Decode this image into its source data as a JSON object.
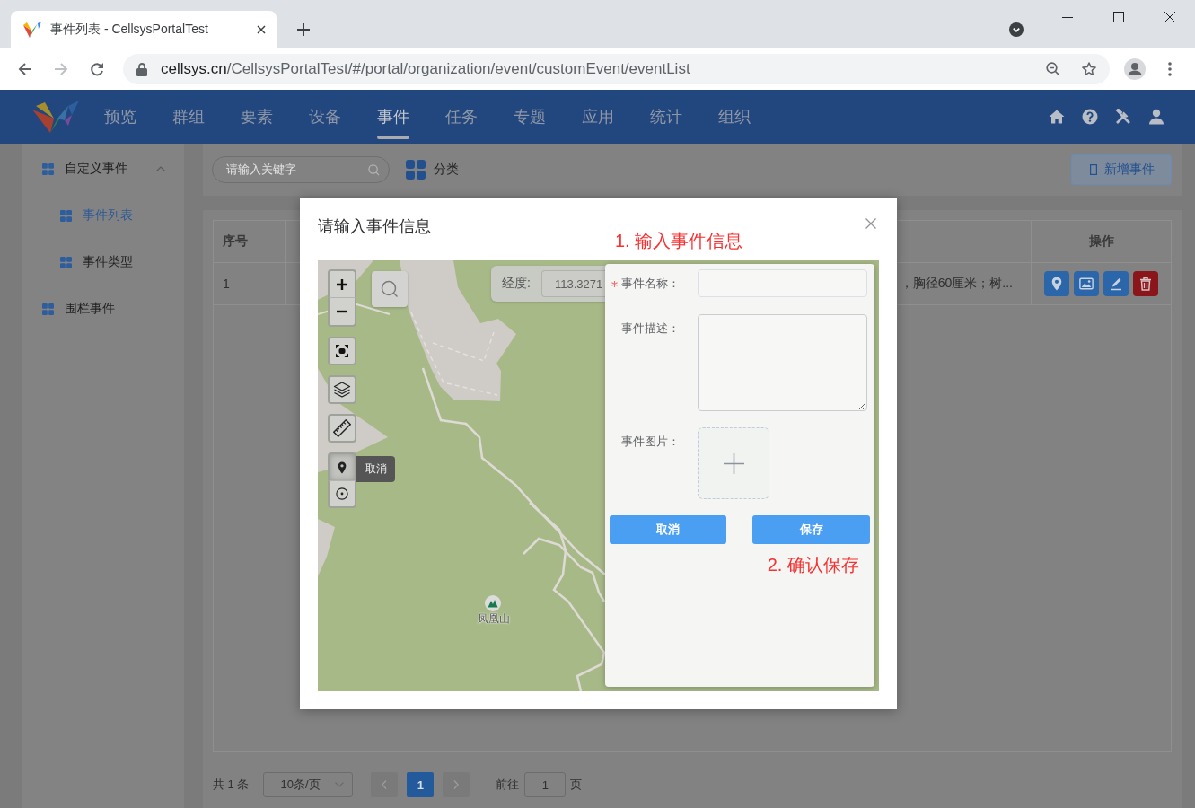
{
  "browser": {
    "tab_title": "事件列表 - CellsysPortalTest",
    "url_host": "cellsys.cn",
    "url_path": "/CellsysPortalTest/#/portal/organization/event/customEvent/eventList",
    "forward_disabled": true
  },
  "header": {
    "nav": [
      {
        "label": "预览",
        "selected": false
      },
      {
        "label": "群组",
        "selected": false
      },
      {
        "label": "要素",
        "selected": false
      },
      {
        "label": "设备",
        "selected": false
      },
      {
        "label": "事件",
        "selected": true
      },
      {
        "label": "任务",
        "selected": false
      },
      {
        "label": "专题",
        "selected": false
      },
      {
        "label": "应用",
        "selected": false
      },
      {
        "label": "统计",
        "selected": false
      },
      {
        "label": "组织",
        "selected": false
      }
    ]
  },
  "sidebar": {
    "items": [
      {
        "label": "自定义事件",
        "selected": false,
        "expanded": true,
        "children": [
          {
            "label": "事件列表",
            "selected": true
          },
          {
            "label": "事件类型",
            "selected": false
          }
        ]
      },
      {
        "label": "围栏事件",
        "selected": false
      }
    ]
  },
  "toolbar": {
    "search": {
      "placeholder": "请输入关键字"
    },
    "category_label": "分类",
    "add_button": "新增事件"
  },
  "table": {
    "columns": {
      "index": "序号",
      "actions": "操作"
    },
    "rows": [
      {
        "index": "1",
        "partial_text": "，胸径60厘米；树..."
      }
    ]
  },
  "pagination": {
    "total": "共 1 条",
    "page_size": "10条/页",
    "prev_disabled": true,
    "pages": [
      {
        "label": "1",
        "selected": true
      }
    ],
    "next_disabled": true,
    "goto_label": "前往",
    "goto_value": "1",
    "goto_suffix": "页"
  },
  "dialog": {
    "title": "请输入事件信息",
    "step_note": "1. 输入事件信息",
    "map": {
      "coordinate": {
        "label": "经度:",
        "value": "113.3271"
      },
      "tooltip": "取消",
      "places": [
        {
          "name": "凤凰山"
        }
      ]
    },
    "form": {
      "fields": [
        {
          "kind": "input",
          "label": "事件名称：",
          "required": true
        },
        {
          "kind": "textarea",
          "label": "事件描述：",
          "required": false
        },
        {
          "kind": "upload",
          "label": "事件图片：",
          "required": false
        }
      ],
      "buttons": [
        {
          "label": "取消"
        },
        {
          "label": "保存"
        }
      ],
      "step_note": "2. 确认保存"
    }
  }
}
